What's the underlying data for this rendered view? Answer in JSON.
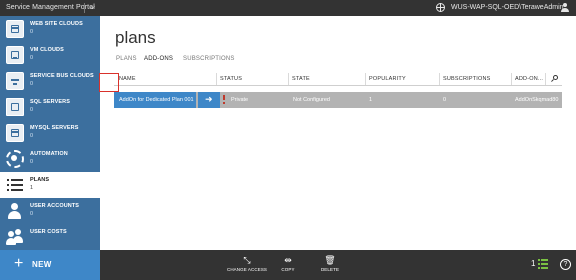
{
  "topbar": {
    "title": "Service Management Portal",
    "user": "WUS-WAP-SQL-OED\\TeraweAdmin",
    "icons": [
      "chevron-down-icon",
      "globe-icon",
      "user-icon"
    ]
  },
  "sidebar": {
    "items": [
      {
        "label": "WEB SITE CLOUDS",
        "count": "0",
        "icon": "website-icon"
      },
      {
        "label": "VM CLOUDS",
        "count": "0",
        "icon": "monitor-icon"
      },
      {
        "label": "SERVICE BUS CLOUDS",
        "count": "0",
        "icon": "service-bus-icon"
      },
      {
        "label": "SQL SERVERS",
        "count": "0",
        "icon": "sql-icon"
      },
      {
        "label": "MYSQL SERVERS",
        "count": "0",
        "icon": "mysql-icon"
      },
      {
        "label": "AUTOMATION",
        "count": "0",
        "icon": "gear-icon"
      },
      {
        "label": "PLANS",
        "count": "1",
        "icon": "list-icon",
        "active": true
      },
      {
        "label": "USER ACCOUNTS",
        "count": "0",
        "icon": "person-icon"
      },
      {
        "label": "USER COSTS",
        "count": "",
        "icon": "people-icon"
      }
    ]
  },
  "main": {
    "title": "plans",
    "tabs": [
      {
        "label": "PLANS"
      },
      {
        "label": "ADD-ONS",
        "active": true
      },
      {
        "label": "SUBSCRIPTIONS"
      }
    ],
    "columns": [
      "NAME",
      "STATUS",
      "STATE",
      "POPULARITY",
      "SUBSCRIPTIONS",
      "ADD-ON..."
    ],
    "rows": [
      {
        "name": "AddOn for Dedicated Plan 001",
        "status": "Private",
        "state": "Not Configured",
        "popularity": "1",
        "subscriptions": "0",
        "addon": "AddOnSkqmad80"
      }
    ]
  },
  "bottombar": {
    "new_label": "NEW",
    "commands": [
      {
        "label": "CHANGE ACCESS",
        "icon": "change-access-icon"
      },
      {
        "label": "COPY",
        "icon": "copy-icon"
      },
      {
        "label": "DELETE",
        "icon": "trash-icon"
      }
    ],
    "status_count": "1",
    "help": "?"
  },
  "colors": {
    "sidebar": "#3c6f9e",
    "accent": "#3e87c8",
    "topbar": "#333333",
    "row_selected": "#b3b3b3",
    "highlight": "#d9312b",
    "status_green": "#7ac143"
  }
}
